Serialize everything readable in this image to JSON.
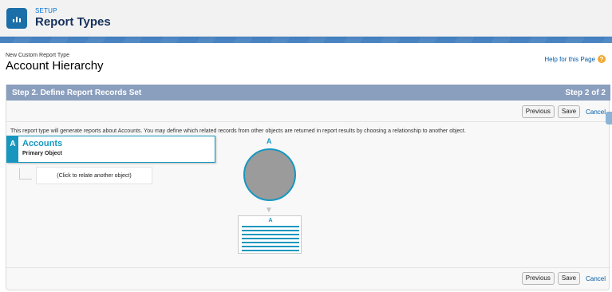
{
  "header": {
    "section_label": "SETUP",
    "title": "Report Types",
    "icon": "report-chart-icon"
  },
  "page": {
    "breadcrumb": "New Custom Report Type",
    "title": "Account Hierarchy",
    "help_link": "Help for this Page",
    "help_icon": "question-icon"
  },
  "step": {
    "title": "Step 2. Define Report Records Set",
    "count": "Step 2 of 2",
    "description": "This report type will generate reports about Accounts. You may define which related records from other objects are returned in report results by choosing a relationship to another object."
  },
  "buttons": {
    "previous": "Previous",
    "save": "Save",
    "cancel": "Cancel"
  },
  "primary_object": {
    "letter": "A",
    "name": "Accounts",
    "subtitle": "Primary Object"
  },
  "relate_placeholder": "(Click to relate another object)",
  "diagram": {
    "circle_letter": "A",
    "records_letter": "A"
  },
  "colors": {
    "step_bar": "#8a9ebe",
    "accent": "#1797c0",
    "link": "#015ba7"
  }
}
